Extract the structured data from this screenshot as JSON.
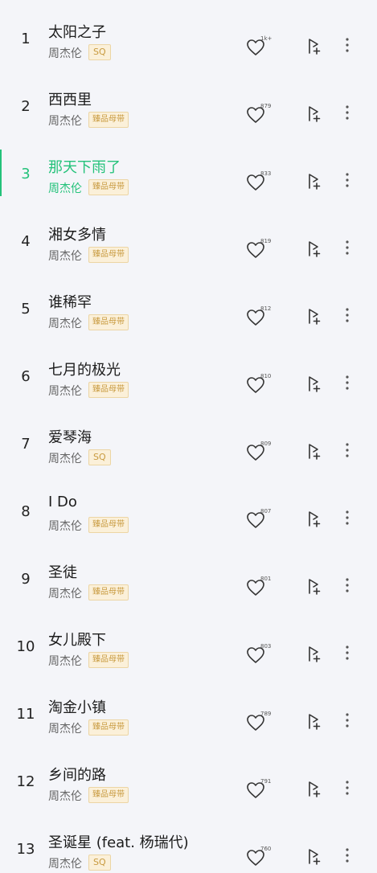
{
  "theme": {
    "active_color": "#24c27a",
    "tag_text_color": "#c89a3f",
    "tag_bg_color": "#fbf0d9",
    "background": "#f4f5f9"
  },
  "songs": [
    {
      "rank": "1",
      "title": "太阳之子",
      "artist": "周杰伦",
      "tag": "SQ",
      "likes": "1k+",
      "active": false
    },
    {
      "rank": "2",
      "title": "西西里",
      "artist": "周杰伦",
      "tag": "臻品母带",
      "likes": "879",
      "active": false
    },
    {
      "rank": "3",
      "title": "那天下雨了",
      "artist": "周杰伦",
      "tag": "臻品母带",
      "likes": "833",
      "active": true
    },
    {
      "rank": "4",
      "title": "湘女多情",
      "artist": "周杰伦",
      "tag": "臻品母带",
      "likes": "819",
      "active": false
    },
    {
      "rank": "5",
      "title": "谁稀罕",
      "artist": "周杰伦",
      "tag": "臻品母带",
      "likes": "812",
      "active": false
    },
    {
      "rank": "6",
      "title": "七月的极光",
      "artist": "周杰伦",
      "tag": "臻品母带",
      "likes": "810",
      "active": false
    },
    {
      "rank": "7",
      "title": "爱琴海",
      "artist": "周杰伦",
      "tag": "SQ",
      "likes": "809",
      "active": false
    },
    {
      "rank": "8",
      "title": "I Do",
      "artist": "周杰伦",
      "tag": "臻品母带",
      "likes": "807",
      "active": false
    },
    {
      "rank": "9",
      "title": "圣徒",
      "artist": "周杰伦",
      "tag": "臻品母带",
      "likes": "801",
      "active": false
    },
    {
      "rank": "10",
      "title": "女儿殿下",
      "artist": "周杰伦",
      "tag": "臻品母带",
      "likes": "803",
      "active": false
    },
    {
      "rank": "11",
      "title": "淘金小镇",
      "artist": "周杰伦",
      "tag": "臻品母带",
      "likes": "789",
      "active": false
    },
    {
      "rank": "12",
      "title": "乡间的路",
      "artist": "周杰伦",
      "tag": "臻品母带",
      "likes": "791",
      "active": false
    },
    {
      "rank": "13",
      "title": "圣诞星 (feat. 杨瑞代)",
      "artist": "周杰伦",
      "tag": "SQ",
      "likes": "760",
      "active": false
    }
  ]
}
